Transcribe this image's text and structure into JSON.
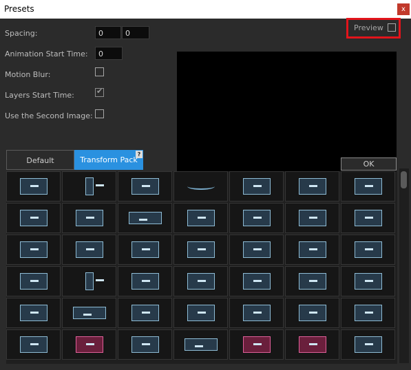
{
  "window": {
    "title": "Presets",
    "close_label": "x"
  },
  "settings": {
    "spacing": {
      "label": "Spacing:",
      "value_x": "0",
      "value_y": "0"
    },
    "animation_start": {
      "label": "Animation Start Time:",
      "value": "0"
    },
    "motion_blur": {
      "label": "Motion Blur:",
      "checked": false
    },
    "layers_start": {
      "label": "Layers Start Time:",
      "checked": true
    },
    "second_image": {
      "label": "Use the Second Image:",
      "checked": false
    }
  },
  "preview": {
    "label": "Preview",
    "checked": false
  },
  "tabs": [
    {
      "label": "Default",
      "active": false
    },
    {
      "label": "Transform Pack",
      "active": true
    }
  ],
  "help": {
    "label": "?"
  },
  "ok": {
    "label": "OK"
  },
  "colors": {
    "accent": "#2a91e0",
    "highlight": "#e3141b",
    "thumb_border": "#8fbdd6",
    "thumb_pink": "#e0609a"
  },
  "presets_grid": {
    "columns": 7,
    "rows": 6,
    "thumbnail_icons": [
      "preset-thumb",
      "preset-thumb-thin",
      "preset-thumb",
      "preset-thumb-arc",
      "preset-thumb",
      "preset-thumb",
      "preset-thumb",
      "preset-thumb",
      "preset-thumb",
      "preset-thumb-wide",
      "preset-thumb",
      "preset-thumb",
      "preset-thumb",
      "preset-thumb",
      "preset-thumb",
      "preset-thumb",
      "preset-thumb",
      "preset-thumb",
      "preset-thumb",
      "preset-thumb",
      "preset-thumb",
      "preset-thumb",
      "preset-thumb-thin",
      "preset-thumb",
      "preset-thumb",
      "preset-thumb",
      "preset-thumb",
      "preset-thumb",
      "preset-thumb",
      "preset-thumb-wide",
      "preset-thumb",
      "preset-thumb",
      "preset-thumb",
      "preset-thumb",
      "preset-thumb",
      "preset-thumb",
      "preset-thumb-pink",
      "preset-thumb",
      "preset-thumb-wide",
      "preset-thumb-pink",
      "preset-thumb-pink",
      "preset-thumb"
    ]
  }
}
